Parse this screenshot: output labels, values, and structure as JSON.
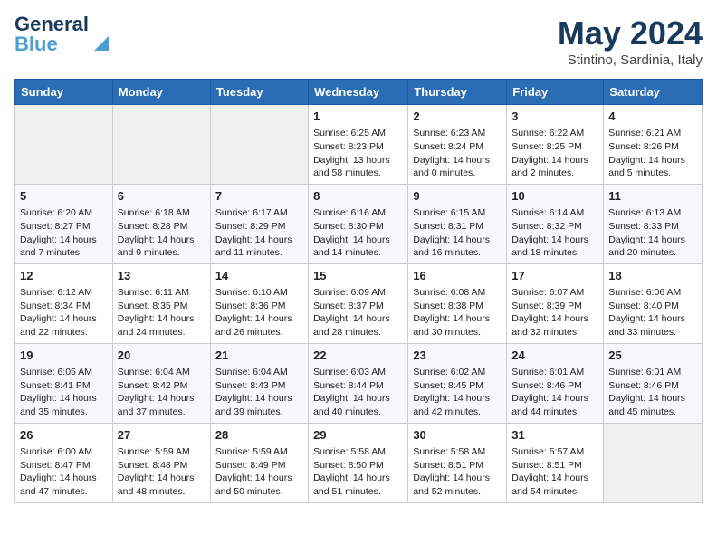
{
  "logo": {
    "line1": "General",
    "line2": "Blue"
  },
  "title": "May 2024",
  "location": "Stintino, Sardinia, Italy",
  "days_of_week": [
    "Sunday",
    "Monday",
    "Tuesday",
    "Wednesday",
    "Thursday",
    "Friday",
    "Saturday"
  ],
  "weeks": [
    [
      {
        "day": "",
        "content": ""
      },
      {
        "day": "",
        "content": ""
      },
      {
        "day": "",
        "content": ""
      },
      {
        "day": "1",
        "content": "Sunrise: 6:25 AM\nSunset: 8:23 PM\nDaylight: 13 hours and 58 minutes."
      },
      {
        "day": "2",
        "content": "Sunrise: 6:23 AM\nSunset: 8:24 PM\nDaylight: 14 hours and 0 minutes."
      },
      {
        "day": "3",
        "content": "Sunrise: 6:22 AM\nSunset: 8:25 PM\nDaylight: 14 hours and 2 minutes."
      },
      {
        "day": "4",
        "content": "Sunrise: 6:21 AM\nSunset: 8:26 PM\nDaylight: 14 hours and 5 minutes."
      }
    ],
    [
      {
        "day": "5",
        "content": "Sunrise: 6:20 AM\nSunset: 8:27 PM\nDaylight: 14 hours and 7 minutes."
      },
      {
        "day": "6",
        "content": "Sunrise: 6:18 AM\nSunset: 8:28 PM\nDaylight: 14 hours and 9 minutes."
      },
      {
        "day": "7",
        "content": "Sunrise: 6:17 AM\nSunset: 8:29 PM\nDaylight: 14 hours and 11 minutes."
      },
      {
        "day": "8",
        "content": "Sunrise: 6:16 AM\nSunset: 8:30 PM\nDaylight: 14 hours and 14 minutes."
      },
      {
        "day": "9",
        "content": "Sunrise: 6:15 AM\nSunset: 8:31 PM\nDaylight: 14 hours and 16 minutes."
      },
      {
        "day": "10",
        "content": "Sunrise: 6:14 AM\nSunset: 8:32 PM\nDaylight: 14 hours and 18 minutes."
      },
      {
        "day": "11",
        "content": "Sunrise: 6:13 AM\nSunset: 8:33 PM\nDaylight: 14 hours and 20 minutes."
      }
    ],
    [
      {
        "day": "12",
        "content": "Sunrise: 6:12 AM\nSunset: 8:34 PM\nDaylight: 14 hours and 22 minutes."
      },
      {
        "day": "13",
        "content": "Sunrise: 6:11 AM\nSunset: 8:35 PM\nDaylight: 14 hours and 24 minutes."
      },
      {
        "day": "14",
        "content": "Sunrise: 6:10 AM\nSunset: 8:36 PM\nDaylight: 14 hours and 26 minutes."
      },
      {
        "day": "15",
        "content": "Sunrise: 6:09 AM\nSunset: 8:37 PM\nDaylight: 14 hours and 28 minutes."
      },
      {
        "day": "16",
        "content": "Sunrise: 6:08 AM\nSunset: 8:38 PM\nDaylight: 14 hours and 30 minutes."
      },
      {
        "day": "17",
        "content": "Sunrise: 6:07 AM\nSunset: 8:39 PM\nDaylight: 14 hours and 32 minutes."
      },
      {
        "day": "18",
        "content": "Sunrise: 6:06 AM\nSunset: 8:40 PM\nDaylight: 14 hours and 33 minutes."
      }
    ],
    [
      {
        "day": "19",
        "content": "Sunrise: 6:05 AM\nSunset: 8:41 PM\nDaylight: 14 hours and 35 minutes."
      },
      {
        "day": "20",
        "content": "Sunrise: 6:04 AM\nSunset: 8:42 PM\nDaylight: 14 hours and 37 minutes."
      },
      {
        "day": "21",
        "content": "Sunrise: 6:04 AM\nSunset: 8:43 PM\nDaylight: 14 hours and 39 minutes."
      },
      {
        "day": "22",
        "content": "Sunrise: 6:03 AM\nSunset: 8:44 PM\nDaylight: 14 hours and 40 minutes."
      },
      {
        "day": "23",
        "content": "Sunrise: 6:02 AM\nSunset: 8:45 PM\nDaylight: 14 hours and 42 minutes."
      },
      {
        "day": "24",
        "content": "Sunrise: 6:01 AM\nSunset: 8:46 PM\nDaylight: 14 hours and 44 minutes."
      },
      {
        "day": "25",
        "content": "Sunrise: 6:01 AM\nSunset: 8:46 PM\nDaylight: 14 hours and 45 minutes."
      }
    ],
    [
      {
        "day": "26",
        "content": "Sunrise: 6:00 AM\nSunset: 8:47 PM\nDaylight: 14 hours and 47 minutes."
      },
      {
        "day": "27",
        "content": "Sunrise: 5:59 AM\nSunset: 8:48 PM\nDaylight: 14 hours and 48 minutes."
      },
      {
        "day": "28",
        "content": "Sunrise: 5:59 AM\nSunset: 8:49 PM\nDaylight: 14 hours and 50 minutes."
      },
      {
        "day": "29",
        "content": "Sunrise: 5:58 AM\nSunset: 8:50 PM\nDaylight: 14 hours and 51 minutes."
      },
      {
        "day": "30",
        "content": "Sunrise: 5:58 AM\nSunset: 8:51 PM\nDaylight: 14 hours and 52 minutes."
      },
      {
        "day": "31",
        "content": "Sunrise: 5:57 AM\nSunset: 8:51 PM\nDaylight: 14 hours and 54 minutes."
      },
      {
        "day": "",
        "content": ""
      }
    ]
  ]
}
